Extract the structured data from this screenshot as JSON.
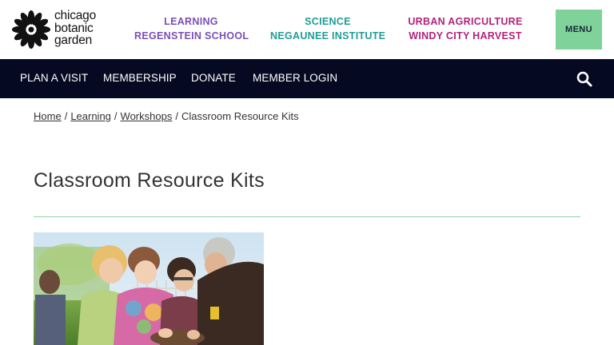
{
  "header": {
    "logo": {
      "line1": "chicago",
      "line2": "botanic",
      "line3": "garden"
    },
    "divisions": [
      {
        "line1": "LEARNING",
        "line2": "REGENSTEIN SCHOOL",
        "color": "#7a4fb6"
      },
      {
        "line1": "SCIENCE",
        "line2": "NEGAUNEE INSTITUTE",
        "color": "#1e9c97"
      },
      {
        "line1": "URBAN AGRICULTURE",
        "line2": "WINDY CITY HARVEST",
        "color": "#b3227a"
      }
    ],
    "menu_label": "MENU",
    "menu_color": "#7fd39a"
  },
  "nav": {
    "background": "#050a22",
    "items": [
      "PLAN A VISIT",
      "MEMBERSHIP",
      "DONATE",
      "MEMBER LOGIN"
    ],
    "search_icon": "search-icon"
  },
  "breadcrumb": {
    "items": [
      "Home",
      "Learning",
      "Workshops"
    ],
    "separator": "/",
    "current": "Classroom Resource Kits"
  },
  "page": {
    "title": "Classroom Resource Kits",
    "rule_color": "#8fd3a6"
  }
}
